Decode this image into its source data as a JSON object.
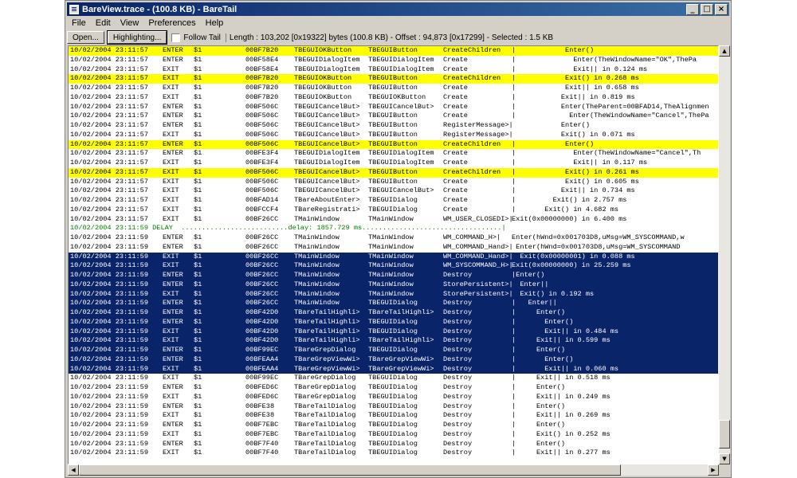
{
  "window": {
    "title": "BareView.trace - (100.8 KB) - BareTail"
  },
  "title_buttons": [
    "_",
    "□",
    "×"
  ],
  "menu": [
    "File",
    "Edit",
    "View",
    "Preferences",
    "Help"
  ],
  "toolbar": {
    "open_label": "Open...",
    "highlighting_label": "Highlighting...",
    "follow_tail_label": "Follow Tail",
    "follow_tail_checked": false,
    "info": "Length : 103,202 [0x19322] bytes (100.8 KB) - Offset : 94,873 [0x17299] - Selected : 1.5 KB"
  },
  "colors": {
    "highlight_yellow": "#ffff00",
    "selection": "#0a246a",
    "delay_green": "#008000"
  },
  "log_rows": [
    {
      "style": "yellow",
      "ts": "10/02/2004 23:11:57",
      "ev": "ENTER",
      "n": "$1",
      "addr": "00BF7B20",
      "cls1": "TBEGUIOKButton",
      "cls2": "TBEGUIButton",
      "fn": "CreateChildren",
      "msg": "|            Enter()"
    },
    {
      "style": "normal",
      "ts": "10/02/2004 23:11:57",
      "ev": "ENTER",
      "n": "$1",
      "addr": "00BF58E4",
      "cls1": "TBEGUIDialogItem",
      "cls2": "TBEGUIDialogItem",
      "fn": "Create",
      "msg": "|              Enter(TheWindowName=\"OK\",ThePa"
    },
    {
      "style": "normal",
      "ts": "10/02/2004 23:11:57",
      "ev": "EXIT",
      "n": "$1",
      "addr": "00BF58E4",
      "cls1": "TBEGUIDialogItem",
      "cls2": "TBEGUIDialogItem",
      "fn": "Create",
      "msg": "|              Exit|| in 0.124 ms"
    },
    {
      "style": "yellow",
      "ts": "10/02/2004 23:11:57",
      "ev": "EXIT",
      "n": "$1",
      "addr": "00BF7B20",
      "cls1": "TBEGUIOKButton",
      "cls2": "TBEGUIButton",
      "fn": "CreateChildren",
      "msg": "|            Exit() in 0.268 ms"
    },
    {
      "style": "normal",
      "ts": "10/02/2004 23:11:57",
      "ev": "EXIT",
      "n": "$1",
      "addr": "00BF7B20",
      "cls1": "TBEGUIOKButton",
      "cls2": "TBEGUIButton",
      "fn": "Create",
      "msg": "|            Exit|| in 0.658 ms"
    },
    {
      "style": "normal",
      "ts": "10/02/2004 23:11:57",
      "ev": "EXIT",
      "n": "$1",
      "addr": "00BF7B20",
      "cls1": "TBEGUIOKButton",
      "cls2": "TBEGUIOKButton",
      "fn": "Create",
      "msg": "|           Exit|| in 0.819 ms"
    },
    {
      "style": "normal",
      "ts": "10/02/2004 23:11:57",
      "ev": "ENTER",
      "n": "$1",
      "addr": "00BF506C",
      "cls1": "TBEGUICancelBut>",
      "cls2": "TBEGUICancelBut>",
      "fn": "Create",
      "msg": "|           Enter(TheParent=00BFAD14,TheAlignmen"
    },
    {
      "style": "normal",
      "ts": "10/02/2004 23:11:57",
      "ev": "ENTER",
      "n": "$1",
      "addr": "00BF506C",
      "cls1": "TBEGUICancelBut>",
      "cls2": "TBEGUIButton",
      "fn": "Create",
      "msg": "|             Enter(TheWindowName=\"Cancel\",ThePa"
    },
    {
      "style": "normal",
      "ts": "10/02/2004 23:11:57",
      "ev": "ENTER",
      "n": "$1",
      "addr": "00BF506C",
      "cls1": "TBEGUICancelBut>",
      "cls2": "TBEGUIButton",
      "fn": "RegisterMessage>|",
      "msg": "            Enter()"
    },
    {
      "style": "normal",
      "ts": "10/02/2004 23:11:57",
      "ev": "EXIT",
      "n": "$1",
      "addr": "00BF506C",
      "cls1": "TBEGUICancelBut>",
      "cls2": "TBEGUIButton",
      "fn": "RegisterMessage>|",
      "msg": "            Exit() in 0.071 ms"
    },
    {
      "style": "yellow",
      "ts": "10/02/2004 23:11:57",
      "ev": "ENTER",
      "n": "$1",
      "addr": "00BF506C",
      "cls1": "TBEGUICancelBut>",
      "cls2": "TBEGUIButton",
      "fn": "CreateChildren",
      "msg": "|            Enter()"
    },
    {
      "style": "normal",
      "ts": "10/02/2004 23:11:57",
      "ev": "ENTER",
      "n": "$1",
      "addr": "00BFE3F4",
      "cls1": "TBEGUIDialogItem",
      "cls2": "TBEGUIDialogItem",
      "fn": "Create",
      "msg": "|              Enter(TheWindowName=\"Cancel\",Th"
    },
    {
      "style": "normal",
      "ts": "10/02/2004 23:11:57",
      "ev": "EXIT",
      "n": "$1",
      "addr": "00BFE3F4",
      "cls1": "TBEGUIDialogItem",
      "cls2": "TBEGUIDialogItem",
      "fn": "Create",
      "msg": "|              Exit|| in 0.117 ms"
    },
    {
      "style": "yellow",
      "ts": "10/02/2004 23:11:57",
      "ev": "EXIT",
      "n": "$1",
      "addr": "00BF506C",
      "cls1": "TBEGUICancelBut>",
      "cls2": "TBEGUIButton",
      "fn": "CreateChildren",
      "msg": "|            Exit() in 0.261 ms"
    },
    {
      "style": "normal",
      "ts": "10/02/2004 23:11:57",
      "ev": "EXIT",
      "n": "$1",
      "addr": "00BF506C",
      "cls1": "TBEGUICancelBut>",
      "cls2": "TBEGUIButton",
      "fn": "Create",
      "msg": "|            Exit() in 0.605 ms"
    },
    {
      "style": "normal",
      "ts": "10/02/2004 23:11:57",
      "ev": "EXIT",
      "n": "$1",
      "addr": "00BF506C",
      "cls1": "TBEGUICancelBut>",
      "cls2": "TBEGUICancelBut>",
      "fn": "Create",
      "msg": "|           Exit|| in 0.734 ms"
    },
    {
      "style": "normal",
      "ts": "10/02/2004 23:11:57",
      "ev": "EXIT",
      "n": "$1",
      "addr": "00BFAD14",
      "cls1": "TBareAboutEnter>",
      "cls2": "TBEGUIDialog",
      "fn": "Create",
      "msg": "|         Exit() in 2.757 ms"
    },
    {
      "style": "normal",
      "ts": "10/02/2004 23:11:57",
      "ev": "EXIT",
      "n": "$1",
      "addr": "00BFCCF4",
      "cls1": "TBareRegistrati>",
      "cls2": "TBEGUIDialog",
      "fn": "Create",
      "msg": "|       Exit() in 4.682 ms"
    },
    {
      "style": "normal",
      "ts": "10/02/2004 23:11:57",
      "ev": "EXIT",
      "n": "$1",
      "addr": "00BF26CC",
      "cls1": "TMainWindow",
      "cls2": "TMainWindow",
      "fn": "WM_USER_CLOSEDI>|",
      "msg": "Exit(0x00000000) in 6.400 ms"
    },
    {
      "style": "green",
      "full": "10/02/2004 23:11:59 DELAY  ..........................delay: 1857.729 ms..................................|"
    },
    {
      "style": "normal",
      "ts": "10/02/2004 23:11:59",
      "ev": "ENTER",
      "n": "$1",
      "addr": "00BF26CC",
      "cls1": "TMainWindow",
      "cls2": "TMainWindow",
      "fn": "WM_COMMAND_H>|",
      "msg": "Enter(hWnd=0x001703D8,uMsg=WM_SYSCOMMAND,w"
    },
    {
      "style": "normal",
      "ts": "10/02/2004 23:11:59",
      "ev": "ENTER",
      "n": "$1",
      "addr": "00BF26CC",
      "cls1": "TMainWindow",
      "cls2": "TMainWindow",
      "fn": "WM_COMMAND_Hand>|",
      "msg": " Enter(hWnd=0x001703D8,uMsg=WM_SYSCOMMAND"
    },
    {
      "style": "sel",
      "ts": "10/02/2004 23:11:59",
      "ev": "EXIT",
      "n": "$1",
      "addr": "00BF26CC",
      "cls1": "TMainWindow",
      "cls2": "TMainWindow",
      "fn": "WM_COMMAND_Hand>|",
      "msg": "  Exit(0x00000001) in 0.088 ms"
    },
    {
      "style": "sel",
      "ts": "10/02/2004 23:11:59",
      "ev": "EXIT",
      "n": "$1",
      "addr": "00BF26CC",
      "cls1": "TMainWindow",
      "cls2": "TMainWindow",
      "fn": "WM_SYSCOMMAND_H>|",
      "msg": "Exit(0x00000000) in 25.259 ms"
    },
    {
      "style": "sel",
      "ts": "10/02/2004 23:11:59",
      "ev": "ENTER",
      "n": "$1",
      "addr": "00BF26CC",
      "cls1": "TMainWindow",
      "cls2": "TMainWindow",
      "fn": "Destroy",
      "msg": "|Enter()"
    },
    {
      "style": "sel",
      "ts": "10/02/2004 23:11:59",
      "ev": "ENTER",
      "n": "$1",
      "addr": "00BF26CC",
      "cls1": "TMainWindow",
      "cls2": "TMainWindow",
      "fn": "StorePersistent>|",
      "msg": "  Enter||"
    },
    {
      "style": "sel",
      "ts": "10/02/2004 23:11:59",
      "ev": "EXIT",
      "n": "$1",
      "addr": "00BF26CC",
      "cls1": "TMainWindow",
      "cls2": "TMainWindow",
      "fn": "StorePersistent>|",
      "msg": "  Exit() in 0.192 ms"
    },
    {
      "style": "sel",
      "ts": "10/02/2004 23:11:59",
      "ev": "ENTER",
      "n": "$1",
      "addr": "00BF26CC",
      "cls1": "TMainWindow",
      "cls2": "TBEGUIDialog",
      "fn": "Destroy",
      "msg": "|   Enter||"
    },
    {
      "style": "sel",
      "ts": "10/02/2004 23:11:59",
      "ev": "ENTER",
      "n": "$1",
      "addr": "00BF42D0",
      "cls1": "TBareTailHighli>",
      "cls2": "TBareTailHighli>",
      "fn": "Destroy",
      "msg": "|     Enter()"
    },
    {
      "style": "sel",
      "ts": "10/02/2004 23:11:59",
      "ev": "ENTER",
      "n": "$1",
      "addr": "00BF42D0",
      "cls1": "TBareTailHighli>",
      "cls2": "TBEGUIDialog",
      "fn": "Destroy",
      "msg": "|       Enter()"
    },
    {
      "style": "sel",
      "ts": "10/02/2004 23:11:59",
      "ev": "EXIT",
      "n": "$1",
      "addr": "00BF42D0",
      "cls1": "TBareTailHighli>",
      "cls2": "TBEGUIDialog",
      "fn": "Destroy",
      "msg": "|       Exit|| in 0.484 ms"
    },
    {
      "style": "sel",
      "ts": "10/02/2004 23:11:59",
      "ev": "EXIT",
      "n": "$1",
      "addr": "00BF42D0",
      "cls1": "TBareTailHighli>",
      "cls2": "TBareTailHighli>",
      "fn": "Destroy",
      "msg": "|     Exit|| in 0.599 ms"
    },
    {
      "style": "sel",
      "ts": "10/02/2004 23:11:59",
      "ev": "ENTER",
      "n": "$1",
      "addr": "00BF99EC",
      "cls1": "TBareGrepDialog",
      "cls2": "TBEGUIDialog",
      "fn": "Destroy",
      "msg": "|     Enter()"
    },
    {
      "style": "sel",
      "ts": "10/02/2004 23:11:59",
      "ev": "ENTER",
      "n": "$1",
      "addr": "00BFEAA4",
      "cls1": "TBareGrepViewWi>",
      "cls2": "TBareGrepViewWi>",
      "fn": "Destroy",
      "msg": "|       Enter()"
    },
    {
      "style": "sel",
      "ts": "10/02/2004 23:11:59",
      "ev": "EXIT",
      "n": "$1",
      "addr": "00BFEAA4",
      "cls1": "TBareGrepViewWi>",
      "cls2": "TBareGrepViewWi>",
      "fn": "Destroy",
      "msg": "|       Exit|| in 0.060 ms"
    },
    {
      "style": "normal",
      "ts": "10/02/2004 23:11:59",
      "ev": "EXIT",
      "n": "$1",
      "addr": "00BF99EC",
      "cls1": "TBareGrepDialog",
      "cls2": "TBEGUIDialog",
      "fn": "Destroy",
      "msg": "|     Exit|| in 0.518 ms"
    },
    {
      "style": "normal",
      "ts": "10/02/2004 23:11:59",
      "ev": "ENTER",
      "n": "$1",
      "addr": "00BFED6C",
      "cls1": "TBareGrepDialog",
      "cls2": "TBEGUIDialog",
      "fn": "Destroy",
      "msg": "|     Enter()"
    },
    {
      "style": "normal",
      "ts": "10/02/2004 23:11:59",
      "ev": "EXIT",
      "n": "$1",
      "addr": "00BFED6C",
      "cls1": "TBareGrepDialog",
      "cls2": "TBEGUIDialog",
      "fn": "Destroy",
      "msg": "|     Exit|| in 0.249 ms"
    },
    {
      "style": "normal",
      "ts": "10/02/2004 23:11:59",
      "ev": "ENTER",
      "n": "$1",
      "addr": "00BFE38",
      "cls1": "TBareTailDialog",
      "cls2": "TBEGUIDialog",
      "fn": "Destroy",
      "msg": "|     Enter()"
    },
    {
      "style": "normal",
      "ts": "10/02/2004 23:11:59",
      "ev": "EXIT",
      "n": "$1",
      "addr": "00BFE38",
      "cls1": "TBareTailDialog",
      "cls2": "TBEGUIDialog",
      "fn": "Destroy",
      "msg": "|     Exit|| in 0.269 ms"
    },
    {
      "style": "normal",
      "ts": "10/02/2004 23:11:59",
      "ev": "ENTER",
      "n": "$1",
      "addr": "00BF7EBC",
      "cls1": "TBareTailDialog",
      "cls2": "TBEGUIDialog",
      "fn": "Destroy",
      "msg": "|     Enter()"
    },
    {
      "style": "normal",
      "ts": "10/02/2004 23:11:59",
      "ev": "EXIT",
      "n": "$1",
      "addr": "00BF7EBC",
      "cls1": "TBareTailDialog",
      "cls2": "TBEGUIDialog",
      "fn": "Destroy",
      "msg": "|     Exit() in 0.252 ms"
    },
    {
      "style": "normal",
      "ts": "10/02/2004 23:11:59",
      "ev": "ENTER",
      "n": "$1",
      "addr": "00BF7F40",
      "cls1": "TBareTailDialog",
      "cls2": "TBEGUIDialog",
      "fn": "Destroy",
      "msg": "|     Enter()"
    },
    {
      "style": "normal",
      "ts": "10/02/2004 23:11:59",
      "ev": "EXIT",
      "n": "$1",
      "addr": "00BF7F40",
      "cls1": "TBareTailDialog",
      "cls2": "TBEGUIDialog",
      "fn": "Destroy",
      "msg": "|     Exit|| in 0.277 ms"
    }
  ]
}
